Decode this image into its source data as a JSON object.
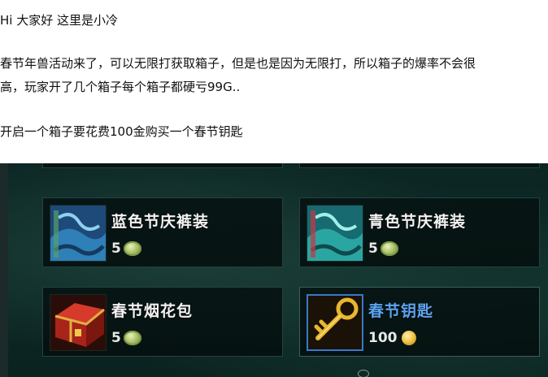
{
  "article": {
    "greeting": "Hi 大家好 这里是小冷",
    "intro_line1": "春节年兽活动来了，可以无限打获取箱子，但是也是因为无限打，所以箱子的爆率不会很",
    "intro_line2": "高，玩家开了几个箱子每个箱子都硬亏99G..",
    "cost_line": "开启一个箱子要花费100金购买一个春节钥匙"
  },
  "shop": {
    "items": [
      {
        "title": "蓝色节庆裤装",
        "price": "5",
        "currency_icon": "green-gem-coin-icon"
      },
      {
        "title": "青色节庆裤装",
        "price": "5",
        "currency_icon": "green-gem-coin-icon"
      },
      {
        "title": "春节烟花包",
        "price": "5",
        "currency_icon": "green-gem-coin-icon"
      },
      {
        "title": "春节钥匙",
        "price": "100",
        "currency_icon": "gold-coin-icon"
      }
    ],
    "colors": {
      "selected_title": "#5da4f0",
      "title": "#f2f2f2",
      "card_border": "#24423e",
      "selected_border": "#3b78c8"
    }
  }
}
